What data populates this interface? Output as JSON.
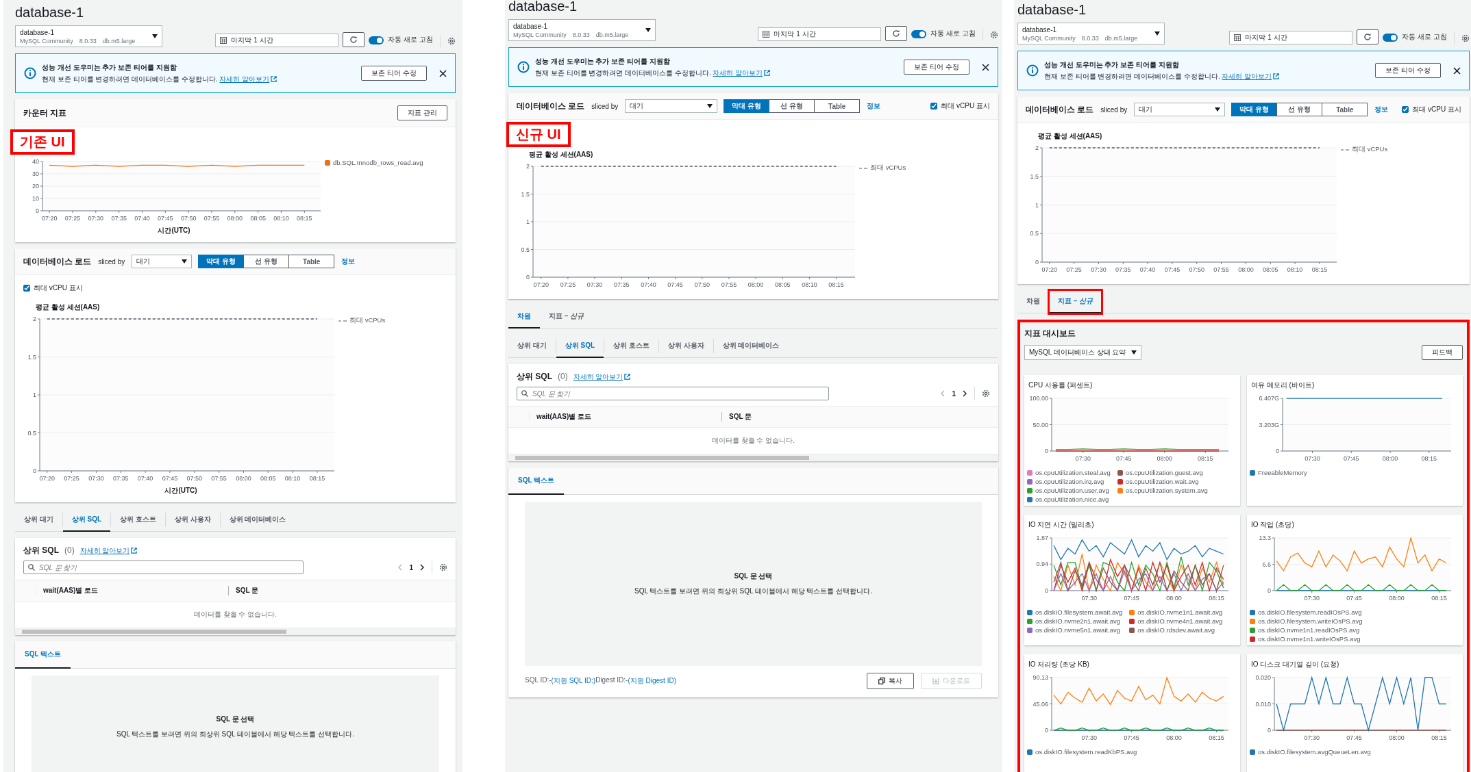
{
  "panels": [
    {
      "header": {
        "title": "database-1",
        "instance": {
          "name": "database-1",
          "engine": "MySQL Community",
          "version": "8.0.33",
          "class": "db.m5.large"
        },
        "time_range": "마지막 1 시간",
        "auto_refresh": {
          "label": "자동 새로 고침",
          "on": true
        }
      },
      "banner": {
        "title": "성능 개선 도우미는 추가 보존 티어를 지원함",
        "text": "현재 보존 티어를 변경하려면 데이터베이스를 수정합니다.",
        "link": "자세히 알아보기",
        "button": "보존 티어 수정"
      },
      "sections": [
        {
          "kind": "counter_metrics",
          "title": "카운터 지표",
          "button": "지표 관리",
          "annotation": "기존 UI",
          "chart_data": {
            "type": "line",
            "xlabel": "시간(UTC)",
            "categories": [
              "07:20",
              "07:25",
              "07:30",
              "07:35",
              "07:40",
              "07:45",
              "07:50",
              "07:55",
              "08:00",
              "08:05",
              "08:10",
              "08:15"
            ],
            "ylim": [
              0,
              40
            ],
            "yticks": [
              0,
              10,
              20,
              30,
              40
            ],
            "grid": true,
            "legend": "right",
            "series": [
              {
                "name": "db.SQL.Innodb_rows_read.avg",
                "color": "#ec7211",
                "values": [
                  37,
                  36,
                  37,
                  36,
                  37,
                  37,
                  36,
                  37,
                  36,
                  37,
                  37,
                  37
                ]
              }
            ]
          }
        },
        {
          "kind": "db_load",
          "title": "데이터베이스 로드",
          "sliced_by": {
            "label": "sliced by",
            "value": "대기"
          },
          "views": [
            {
              "label": "막대 유형",
              "selected": true
            },
            {
              "label": "선 유형",
              "selected": false
            },
            {
              "label": "Table",
              "selected": false
            }
          ],
          "info": "정보",
          "checkbox": {
            "label": "최대 vCPU 표시",
            "checked": true
          },
          "chart_data": {
            "type": "line",
            "title": "평균 활성 세션(AAS)",
            "xlabel": "시간(UTC)",
            "categories": [
              "07:20",
              "07:25",
              "07:30",
              "07:35",
              "07:40",
              "07:45",
              "07:50",
              "07:55",
              "08:00",
              "08:05",
              "08:10",
              "08:15"
            ],
            "ylim": [
              0,
              2
            ],
            "yticks": [
              0,
              0.5,
              1,
              1.5,
              2
            ],
            "grid": true,
            "legend": "right",
            "series": [
              {
                "name": "최대 vCPUs",
                "color": "#545b64",
                "line_style": "dashed",
                "values": [
                  2,
                  2,
                  2,
                  2,
                  2,
                  2,
                  2,
                  2,
                  2,
                  2,
                  2,
                  2
                ]
              }
            ]
          }
        },
        {
          "kind": "tabs",
          "tabs": [
            {
              "label": "상위 대기",
              "selected": false
            },
            {
              "label": "상위 SQL",
              "selected": true
            },
            {
              "label": "상위 호스트",
              "selected": false
            },
            {
              "label": "상위 사용자",
              "selected": false
            },
            {
              "label": "상위 데이터베이스",
              "selected": false
            }
          ]
        },
        {
          "kind": "top_sql",
          "title": "상위 SQL",
          "count": "(0)",
          "link": "자세히 알아보기",
          "search_placeholder": "SQL 문 찾기",
          "page": "1",
          "columns": [
            "wait(AAS)별 로드",
            "SQL 문"
          ],
          "empty": "데이터를 찾을 수 없습니다."
        },
        {
          "kind": "sql_text",
          "tabs": [
            {
              "label": "SQL 텍스트",
              "selected": true
            }
          ],
          "empty_title": "SQL 문 선택",
          "empty_text": "SQL 텍스트를 보려면 위의 최상위 SQL 테이블에서 해당 텍스트를 선택합니다."
        }
      ]
    },
    {
      "header": {
        "title": "database-1",
        "instance": {
          "name": "database-1",
          "engine": "MySQL Community",
          "version": "8.0.33",
          "class": "db.m5.large"
        },
        "time_range": "마지막 1 시간",
        "auto_refresh": {
          "label": "자동 새로 고침",
          "on": true
        }
      },
      "banner": {
        "title": "성능 개선 도우미는 추가 보존 티어를 지원함",
        "text": "현재 보존 티어를 변경하려면 데이터베이스를 수정합니다.",
        "link": "자세히 알아보기",
        "button": "보존 티어 수정"
      },
      "sections": [
        {
          "kind": "db_load",
          "title": "데이터베이스 로드",
          "annotation": "신규 UI",
          "sliced_by": {
            "label": "sliced by",
            "value": "대기"
          },
          "views": [
            {
              "label": "막대 유형",
              "selected": true
            },
            {
              "label": "선 유형",
              "selected": false
            },
            {
              "label": "Table",
              "selected": false
            }
          ],
          "info": "정보",
          "toolbar_checkbox": {
            "label": "최대 vCPU 표시",
            "checked": true
          },
          "chart_data": {
            "type": "line",
            "title": "평균 활성 세션(AAS)",
            "categories": [
              "07:20",
              "07:25",
              "07:30",
              "07:35",
              "07:40",
              "07:45",
              "07:50",
              "07:55",
              "08:00",
              "08:05",
              "08:10",
              "08:15"
            ],
            "ylim": [
              0,
              2
            ],
            "yticks": [
              0,
              0.5,
              1,
              1.5,
              2
            ],
            "grid": true,
            "legend": "right",
            "series": [
              {
                "name": "최대 vCPUs",
                "color": "#545b64",
                "line_style": "dashed",
                "values": [
                  2,
                  2,
                  2,
                  2,
                  2,
                  2,
                  2,
                  2,
                  2,
                  2,
                  2,
                  2
                ]
              }
            ]
          }
        },
        {
          "kind": "tabs",
          "tabs": [
            {
              "label": "차원",
              "selected": true,
              "highlighted": false
            },
            {
              "label": "지표 – *신규*",
              "selected": false,
              "highlighted": false
            }
          ]
        },
        {
          "kind": "tabs",
          "tabs": [
            {
              "label": "상위 대기",
              "selected": false
            },
            {
              "label": "상위 SQL",
              "selected": true
            },
            {
              "label": "상위 호스트",
              "selected": false
            },
            {
              "label": "상위 사용자",
              "selected": false
            },
            {
              "label": "상위 데이터베이스",
              "selected": false
            }
          ]
        },
        {
          "kind": "top_sql",
          "title": "상위 SQL",
          "count": "(0)",
          "link": "자세히 알아보기",
          "search_placeholder": "SQL 문 찾기",
          "page": "1",
          "columns": [
            "wait(AAS)별 로드",
            "SQL 문"
          ],
          "empty": "데이터를 찾을 수 없습니다."
        },
        {
          "kind": "sql_text",
          "tabs": [
            {
              "label": "SQL 텍스트",
              "selected": true
            }
          ],
          "empty_title": "SQL 문 선택",
          "empty_text": "SQL 텍스트를 보려면 위의 최상위 SQL 테이블에서 해당 텍스트를 선택합니다.",
          "footer": [
            {
              "text": "SQL ID:-",
              "kind": "plain"
            },
            {
              "text": "(지원 SQL ID:)",
              "kind": "info"
            },
            {
              "text": "Digest ID:-",
              "kind": "plain"
            },
            {
              "text": "(지원 Digest ID)",
              "kind": "info"
            }
          ],
          "buttons": [
            {
              "label": "복사",
              "disabled": false
            },
            {
              "label": "다운로드",
              "disabled": true
            }
          ]
        }
      ]
    },
    {
      "header": {
        "title": "database-1",
        "instance": {
          "name": "database-1",
          "engine": "MySQL Community",
          "version": "8.0.33",
          "class": "db.m5.large"
        },
        "time_range": "마지막 1 시간",
        "auto_refresh": {
          "label": "자동 새로 고침",
          "on": true
        }
      },
      "banner": {
        "title": "성능 개선 도우미는 추가 보존 티어를 지원함",
        "text": "현재 보존 티어를 변경하려면 데이터베이스를 수정합니다.",
        "link": "자세히 알아보기",
        "button": "보존 티어 수정"
      },
      "sections": [
        {
          "kind": "db_load",
          "title": "데이터베이스 로드",
          "sliced_by": {
            "label": "sliced by",
            "value": "대기"
          },
          "views": [
            {
              "label": "막대 유형",
              "selected": true
            },
            {
              "label": "선 유형",
              "selected": false
            },
            {
              "label": "Table",
              "selected": false
            }
          ],
          "info": "정보",
          "toolbar_checkbox": {
            "label": "최대 vCPU 표시",
            "checked": true
          },
          "chart_data": {
            "type": "line",
            "title": "평균 활성 세션(AAS)",
            "categories": [
              "07:20",
              "07:25",
              "07:30",
              "07:35",
              "07:40",
              "07:45",
              "07:50",
              "07:55",
              "08:00",
              "08:05",
              "08:10",
              "08:15"
            ],
            "ylim": [
              0,
              2
            ],
            "yticks": [
              0,
              0.5,
              1,
              1.5,
              2
            ],
            "grid": true,
            "legend": "right",
            "series": [
              {
                "name": "최대 vCPUs",
                "color": "#545b64",
                "line_style": "dashed",
                "values": [
                  2,
                  2,
                  2,
                  2,
                  2,
                  2,
                  2,
                  2,
                  2,
                  2,
                  2,
                  2
                ]
              }
            ]
          }
        },
        {
          "kind": "tabs",
          "tabs": [
            {
              "label": "차원",
              "selected": false,
              "highlighted": false
            },
            {
              "label": "지표 – *신규*",
              "selected": true,
              "highlighted": true
            }
          ]
        },
        {
          "kind": "dashboard",
          "title": "지표 대시보드",
          "highlighted": true,
          "select": "MySQL 데이터베이스 상태 요약",
          "button": "피드백",
          "charts": [
            {
              "title": "CPU 사용률 (퍼센트)",
              "chart_data": {
                "type": "line",
                "categories": [
                  null,
                  null,
                  "07:30",
                  null,
                  null,
                  "07:45",
                  null,
                  null,
                  "08:00",
                  null,
                  null,
                  "08:15",
                  null
                ],
                "ylim": [
                  0,
                  100
                ],
                "yticks": [
                  {
                    "value": 0,
                    "label": "0"
                  },
                  {
                    "value": 50,
                    "label": "50.00"
                  },
                  {
                    "value": 100,
                    "label": "100.00"
                  }
                ],
                "grid": true,
                "legend": "bottom",
                "series": [
                  {
                    "name": "os.cpuUtilization.steal.avg",
                    "color": "#e377c2",
                    "values": [
                      null,
                      null,
                      null,
                      null,
                      null,
                      null,
                      null,
                      null,
                      null,
                      null,
                      null,
                      null,
                      null
                    ]
                  },
                  {
                    "name": "os.cpuUtilization.guest.avg",
                    "color": "#8c564b",
                    "values": [
                      null,
                      null,
                      null,
                      null,
                      null,
                      null,
                      null,
                      null,
                      null,
                      null,
                      null,
                      null,
                      null
                    ]
                  },
                  {
                    "name": "os.cpuUtilization.irq.avg",
                    "color": "#9467bd",
                    "values": [
                      null,
                      null,
                      null,
                      null,
                      null,
                      null,
                      null,
                      null,
                      null,
                      null,
                      null,
                      null,
                      null
                    ]
                  },
                  {
                    "name": "os.cpuUtilization.wait.avg",
                    "color": "#d62728",
                    "values": [
                      0,
                      0,
                      0,
                      0,
                      0,
                      0,
                      0,
                      0,
                      0,
                      0,
                      0,
                      0,
                      0
                    ]
                  },
                  {
                    "name": "os.cpuUtilization.user.avg",
                    "color": "#2ca02c",
                    "values": [
                      3,
                      3,
                      4,
                      3,
                      3,
                      4,
                      3,
                      3,
                      4,
                      3,
                      3,
                      3,
                      3
                    ]
                  },
                  {
                    "name": "os.cpuUtilization.system.avg",
                    "color": "#ff7f0e",
                    "values": [
                      null,
                      null,
                      null,
                      null,
                      null,
                      null,
                      null,
                      null,
                      null,
                      null,
                      null,
                      null,
                      null
                    ]
                  },
                  {
                    "name": "os.cpuUtilization.nice.avg",
                    "color": "#1f77b4",
                    "values": [
                      null,
                      null,
                      null,
                      null,
                      null,
                      null,
                      null,
                      null,
                      null,
                      null,
                      null,
                      null,
                      null
                    ]
                  }
                ]
              }
            },
            {
              "title": "여유 메모리 (바이트)",
              "chart_data": {
                "type": "line",
                "categories": [
                  null,
                  null,
                  "07:30",
                  null,
                  null,
                  "07:45",
                  null,
                  null,
                  "08:00",
                  null,
                  null,
                  "08:15",
                  null
                ],
                "ylim": [
                  0,
                  6.407
                ],
                "yticks": [
                  {
                    "value": 0,
                    "label": "0"
                  },
                  {
                    "value": 3.203,
                    "label": "3.203G"
                  },
                  {
                    "value": 6.407,
                    "label": "6.407G"
                  }
                ],
                "grid": true,
                "legend": "bottom",
                "series": [
                  {
                    "name": "FreeableMemory",
                    "color": "#1f77b4",
                    "values": [
                      6.4,
                      6.4,
                      6.4,
                      6.4,
                      6.4,
                      6.4,
                      6.4,
                      6.4,
                      6.4,
                      6.4,
                      6.4,
                      6.4,
                      6.4
                    ]
                  }
                ]
              }
            },
            {
              "title": "IO 지연 시간 (밀리초)",
              "chart_data": {
                "type": "line",
                "categories": [
                  null,
                  null,
                  null,
                  null,
                  null,
                  "07:30",
                  null,
                  null,
                  null,
                  null,
                  null,
                  "07:45",
                  null,
                  null,
                  null,
                  null,
                  null,
                  "08:00",
                  null,
                  null,
                  null,
                  null,
                  null,
                  "08:15",
                  null
                ],
                "ylim": [
                  0,
                  1.87
                ],
                "yticks": [
                  {
                    "value": 0,
                    "label": "0"
                  },
                  {
                    "value": 0.94,
                    "label": "0.94"
                  },
                  {
                    "value": 1.87,
                    "label": "1.87"
                  }
                ],
                "grid": true,
                "legend": "bottom",
                "series": [
                  {
                    "name": "os.diskIO.filesystem.await.avg",
                    "color": "#1f77b4",
                    "values": [
                      1.6,
                      1.1,
                      1.5,
                      1.3,
                      1.8,
                      1.4,
                      1.6,
                      1.2,
                      1.7,
                      1.5,
                      1.3,
                      1.8,
                      1.2,
                      1.6,
                      1.4,
                      1.7,
                      1.1,
                      1.5,
                      1.3,
                      1.4,
                      1.6,
                      1.2,
                      1.5,
                      1.4,
                      1.3
                    ]
                  },
                  {
                    "name": "os.diskIO.nvme1n1.await.avg",
                    "color": "#ff7f0e",
                    "values": [
                      0.5,
                      0,
                      0.9,
                      0.2,
                      1.3,
                      0,
                      0.9,
                      0.4,
                      0,
                      1,
                      0.6,
                      0,
                      0.9,
                      0.3,
                      0,
                      1,
                      0.5,
                      0,
                      0.9,
                      0.4,
                      0,
                      0.8,
                      0.3,
                      1,
                      0.2
                    ]
                  },
                  {
                    "name": "os.diskIO.nvme2n1.await.avg",
                    "color": "#2ca02c",
                    "values": [
                      0.9,
                      0.2,
                      1,
                      1,
                      0.1,
                      0.9,
                      0,
                      1,
                      0.9,
                      0.3,
                      0,
                      1,
                      0.2,
                      0.9,
                      0.6,
                      0,
                      1,
                      0.1,
                      1.2,
                      0.2,
                      0.9,
                      0,
                      1,
                      0.7,
                      0.1
                    ]
                  },
                  {
                    "name": "os.diskIO.nvme4n1.await.avg",
                    "color": "#d62728",
                    "values": [
                      0,
                      0.9,
                      0.3,
                      0.8,
                      0,
                      1,
                      0.4,
                      0,
                      1.1,
                      0.5,
                      0.9,
                      0,
                      0.8,
                      0,
                      1,
                      0.3,
                      0.9,
                      0,
                      0.5,
                      0.9,
                      0.2,
                      1,
                      0,
                      0.8,
                      0.4
                    ]
                  },
                  {
                    "name": "os.diskIO.nvme5n1.await.avg",
                    "color": "#9467bd",
                    "values": [
                      0,
                      0.6,
                      0,
                      0.3,
                      0.6,
                      0,
                      0.6,
                      0,
                      0.5,
                      0,
                      0.7,
                      0,
                      0.4,
                      0.6,
                      0,
                      0.5,
                      0,
                      0.6,
                      0,
                      0.6,
                      0,
                      0.4,
                      0.6,
                      0,
                      0.3
                    ]
                  },
                  {
                    "name": "os.diskIO.rdsdev.await.avg",
                    "color": "#8c564b",
                    "values": [
                      0.3,
                      1,
                      0,
                      0.7,
                      0.2,
                      1,
                      0,
                      0.8,
                      0.3,
                      0,
                      0.9,
                      0.4,
                      0,
                      0.8,
                      0.2,
                      1,
                      0,
                      0.7,
                      0.3,
                      0,
                      0.9,
                      0.2,
                      0.6,
                      0,
                      0.9
                    ]
                  }
                ]
              }
            },
            {
              "title": "IO 작업 (초당)",
              "chart_data": {
                "type": "line",
                "categories": [
                  null,
                  null,
                  null,
                  null,
                  null,
                  "07:30",
                  null,
                  null,
                  null,
                  null,
                  null,
                  "07:45",
                  null,
                  null,
                  null,
                  null,
                  null,
                  "08:00",
                  null,
                  null,
                  null,
                  null,
                  null,
                  "08:15",
                  null
                ],
                "ylim": [
                  0,
                  13.3
                ],
                "yticks": [
                  {
                    "value": 0,
                    "label": "0"
                  },
                  {
                    "value": 6.6,
                    "label": "6.6"
                  },
                  {
                    "value": 13.3,
                    "label": "13.3"
                  }
                ],
                "grid": true,
                "legend": "bottom",
                "series": [
                  {
                    "name": "os.diskIO.filesystem.readIOsPS.avg",
                    "color": "#1f77b4",
                    "values": [
                      0,
                      0,
                      0,
                      0,
                      0,
                      0,
                      0,
                      0,
                      0,
                      0,
                      0,
                      0,
                      0,
                      0,
                      0,
                      0,
                      0,
                      0,
                      0,
                      0,
                      0,
                      0,
                      0,
                      0,
                      0
                    ]
                  },
                  {
                    "name": "os.diskIO.filesystem.writeIOsPS.avg",
                    "color": "#ff7f0e",
                    "values": [
                      7.5,
                      5,
                      8.5,
                      9.5,
                      7,
                      6,
                      10,
                      6,
                      9,
                      7.5,
                      5,
                      10,
                      7,
                      8,
                      8.5,
                      6,
                      11,
                      8,
                      6,
                      13.3,
                      7,
                      9,
                      5,
                      8,
                      7
                    ]
                  },
                  {
                    "name": "os.diskIO.nvme1n1.readIOsPS.avg",
                    "color": "#2ca02c",
                    "values": [
                      0,
                      1.5,
                      0,
                      0,
                      1.5,
                      0,
                      0,
                      1.5,
                      0,
                      0,
                      1.5,
                      0,
                      0,
                      1.5,
                      0,
                      0,
                      1.5,
                      0,
                      0,
                      1.5,
                      0,
                      0,
                      1.5,
                      0,
                      0
                    ]
                  },
                  {
                    "name": "os.diskIO.nvme1n1.writeIOsPS.avg",
                    "color": "#d62728",
                    "values": [
                      null,
                      null,
                      null,
                      null,
                      null,
                      null,
                      null,
                      null,
                      null,
                      null,
                      null,
                      null,
                      null,
                      null,
                      null,
                      null,
                      null,
                      null,
                      null,
                      null,
                      null,
                      null,
                      null,
                      null,
                      null
                    ]
                  }
                ]
              }
            },
            {
              "title": "IO 처리량 (초당 KB)",
              "chart_data": {
                "type": "line",
                "categories": [
                  null,
                  null,
                  null,
                  null,
                  null,
                  "07:30",
                  null,
                  null,
                  null,
                  null,
                  null,
                  "07:45",
                  null,
                  null,
                  null,
                  null,
                  null,
                  "08:00",
                  null,
                  null,
                  null,
                  null,
                  null,
                  "08:15",
                  null
                ],
                "ylim": [
                  0,
                  90.13
                ],
                "yticks": [
                  {
                    "value": 0,
                    "label": "0"
                  },
                  {
                    "value": 45.06,
                    "label": "45.06"
                  },
                  {
                    "value": 90.13,
                    "label": "90.13"
                  }
                ],
                "grid": true,
                "legend": "bottom",
                "series": [
                  {
                    "name": "os.diskIO.filesystem.readKbPS.avg",
                    "color": "#1f77b4",
                    "values": [
                      0,
                      0,
                      0,
                      0,
                      0,
                      0,
                      0,
                      0,
                      0,
                      0,
                      0,
                      0,
                      0,
                      0,
                      0,
                      0,
                      0,
                      0,
                      0,
                      0,
                      0,
                      0,
                      0,
                      0,
                      0
                    ]
                  },
                  {
                    "color": "#ff7f0e",
                    "values": [
                      60,
                      45,
                      65,
                      55,
                      48,
                      72,
                      50,
                      62,
                      44,
                      68,
                      55,
                      50,
                      75,
                      52,
                      60,
                      45,
                      90,
                      58,
                      50,
                      62,
                      48,
                      65,
                      55,
                      50,
                      58
                    ]
                  },
                  {
                    "color": "#2ca02c",
                    "values": [
                      0,
                      4,
                      0,
                      0,
                      4,
                      0,
                      0,
                      4,
                      0,
                      0,
                      4,
                      0,
                      0,
                      4,
                      0,
                      0,
                      4,
                      0,
                      0,
                      4,
                      0,
                      0,
                      4,
                      0,
                      0
                    ]
                  }
                ]
              }
            },
            {
              "title": "IO 디스크 대기열 깊이 (요청)",
              "chart_data": {
                "type": "line",
                "categories": [
                  null,
                  null,
                  null,
                  null,
                  null,
                  "07:30",
                  null,
                  null,
                  null,
                  null,
                  null,
                  "07:45",
                  null,
                  null,
                  null,
                  null,
                  null,
                  "08:00",
                  null,
                  null,
                  null,
                  null,
                  null,
                  "08:15",
                  null
                ],
                "ylim": [
                  0,
                  0.02
                ],
                "yticks": [
                  {
                    "value": 0,
                    "label": "0"
                  },
                  {
                    "value": 0.01,
                    "label": "0.010"
                  },
                  {
                    "value": 0.02,
                    "label": "0.020"
                  }
                ],
                "grid": true,
                "legend": "bottom",
                "series": [
                  {
                    "color": "#8c564b",
                    "values": [
                      0,
                      0,
                      0,
                      0,
                      0,
                      0,
                      0,
                      0,
                      0,
                      0,
                      0,
                      0,
                      0,
                      0,
                      0,
                      0,
                      0,
                      0,
                      0,
                      0,
                      0,
                      0,
                      0,
                      0,
                      0
                    ]
                  },
                  {
                    "name": "os.diskIO.filesystem.avgQueueLen.avg",
                    "color": "#1f77b4",
                    "values": [
                      0.01,
                      0,
                      0.01,
                      0.01,
                      0.01,
                      0.02,
                      0.01,
                      0.02,
                      0.01,
                      0.01,
                      0.02,
                      0.01,
                      0.01,
                      0,
                      0.01,
                      0.02,
                      0.01,
                      0.02,
                      0.01,
                      0.02,
                      0,
                      0.02,
                      0.02,
                      0.01,
                      0.01
                    ]
                  }
                ]
              }
            }
          ]
        }
      ]
    }
  ]
}
